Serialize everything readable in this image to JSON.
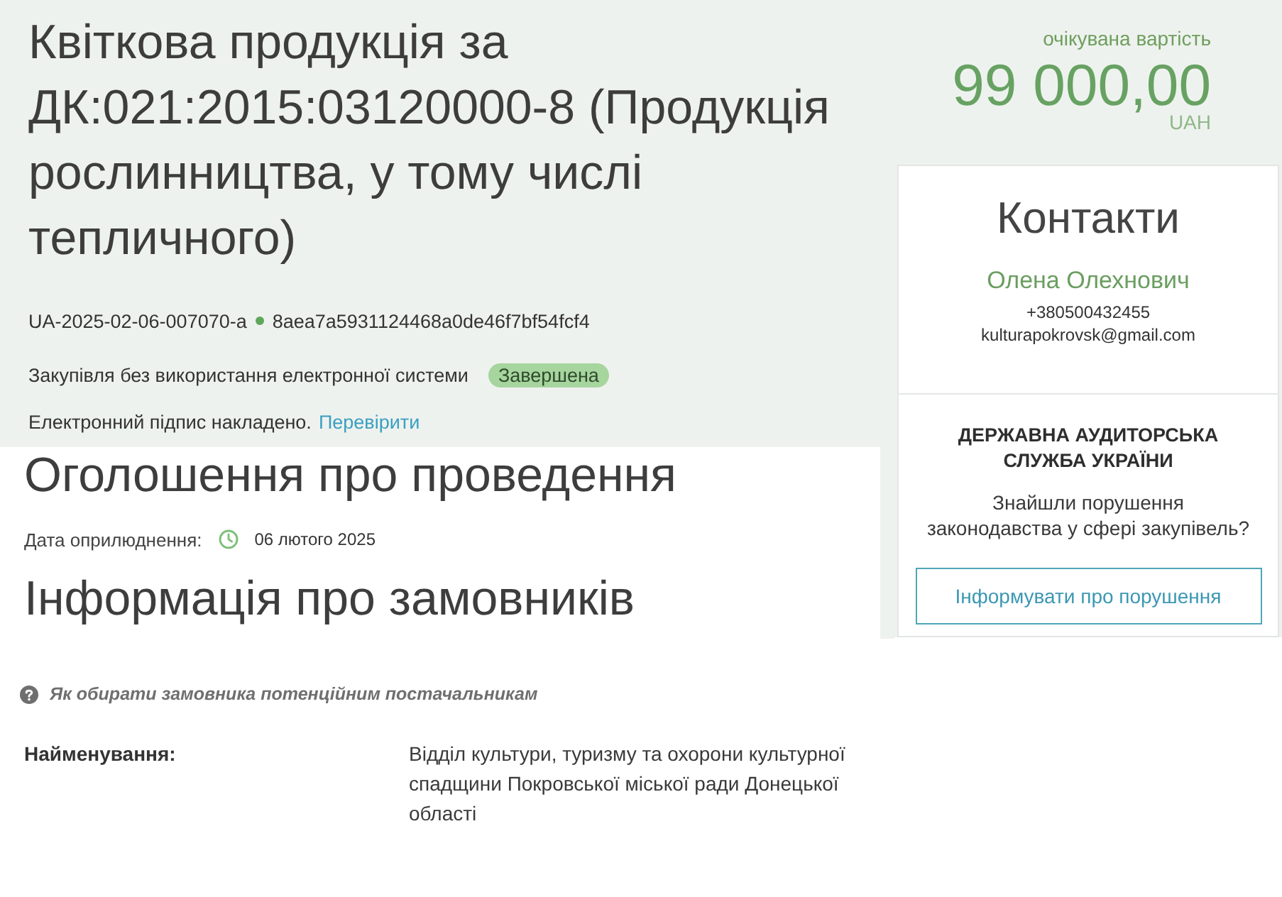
{
  "tender": {
    "title": "Квіткова продукція за ДК:021:2015:03120000-8 (Продукція рослинництва, у тому числі тепличного)",
    "id": "UA-2025-02-06-007070-a",
    "hash": "8aea7a5931124468a0de46f7bf54fcf4",
    "procurement_type": "Закупівля без використання електронної системи",
    "status": "Завершена",
    "signature": {
      "text": "Електронний підпис накладено.",
      "link": "Перевірити"
    }
  },
  "value": {
    "label": "очікувана вартість",
    "amount": "99 000,00",
    "currency": "UAH"
  },
  "contacts": {
    "title": "Контакти",
    "name": "Олена Олехнович",
    "phone": "+380500432455",
    "email": "kulturapokrovsk@gmail.com"
  },
  "audit": {
    "title": "ДЕРЖАВНА АУДИТОРСЬКА СЛУЖБА УКРАЇНИ",
    "question": "Знайшли порушення законодавства у сфері закупівель?",
    "button": "Інформувати про порушення"
  },
  "announcement": {
    "title": "Оголошення про проведення",
    "date_label": "Дата оприлюднення:",
    "date": "06 лютого 2025"
  },
  "customers": {
    "title": "Інформація про замовників",
    "hint": "Як обирати замовника потенційним постачальникам",
    "fields": [
      {
        "label": "Найменування:",
        "value": "Відділ культури, туризму та охорони культурної спадщини Покровської міської ради Донецької області"
      }
    ]
  }
}
